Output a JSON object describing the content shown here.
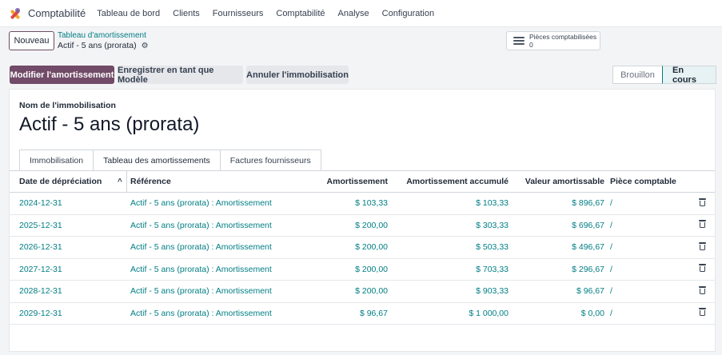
{
  "navbar": {
    "app_title": "Comptabilité",
    "menu": [
      "Tableau de bord",
      "Clients",
      "Fournisseurs",
      "Comptabilité",
      "Analyse",
      "Configuration"
    ]
  },
  "control": {
    "new_label": "Nouveau",
    "breadcrumb": "Tableau d'amortissement",
    "record_title": "Actif - 5 ans (prorata)",
    "smart_button": {
      "label": "Pièces comptabilisées",
      "count": "0"
    }
  },
  "actions": {
    "modify": "Modifier l'amortissement",
    "save_template": "Enregistrer en tant que Modèle",
    "cancel_asset": "Annuler l'immobilisation"
  },
  "status": {
    "stages": [
      "Brouillon",
      "En cours"
    ],
    "current": "En cours"
  },
  "form": {
    "name_label": "Nom de l'immobilisation",
    "name": "Actif - 5 ans (prorata)",
    "tabs": [
      "Immobilisation",
      "Tableau des amortissements",
      "Factures fournisseurs"
    ],
    "active_tab": "Tableau des amortissements"
  },
  "table": {
    "headers": {
      "date": "Date de dépréciation",
      "ref": "Référence",
      "amort": "Amortissement",
      "cumul": "Amortissement accumulé",
      "val": "Valeur amortissable",
      "move": "Pièce comptable"
    },
    "rows": [
      {
        "date": "2024-12-31",
        "ref": "Actif - 5 ans (prorata) : Amortissement",
        "amort": "$ 103,33",
        "cumul": "$ 103,33",
        "val": "$ 896,67",
        "move": "/"
      },
      {
        "date": "2025-12-31",
        "ref": "Actif - 5 ans (prorata) : Amortissement",
        "amort": "$ 200,00",
        "cumul": "$ 303,33",
        "val": "$ 696,67",
        "move": "/"
      },
      {
        "date": "2026-12-31",
        "ref": "Actif - 5 ans (prorata) : Amortissement",
        "amort": "$ 200,00",
        "cumul": "$ 503,33",
        "val": "$ 496,67",
        "move": "/"
      },
      {
        "date": "2027-12-31",
        "ref": "Actif - 5 ans (prorata) : Amortissement",
        "amort": "$ 200,00",
        "cumul": "$ 703,33",
        "val": "$ 296,67",
        "move": "/"
      },
      {
        "date": "2028-12-31",
        "ref": "Actif - 5 ans (prorata) : Amortissement",
        "amort": "$ 200,00",
        "cumul": "$ 903,33",
        "val": "$ 96,67",
        "move": "/"
      },
      {
        "date": "2029-12-31",
        "ref": "Actif - 5 ans (prorata) : Amortissement",
        "amort": "$ 96,67",
        "cumul": "$ 1 000,00",
        "val": "$ 0,00",
        "move": "/"
      }
    ]
  },
  "colors": {
    "brand": "#714b67",
    "link": "#017e84"
  }
}
